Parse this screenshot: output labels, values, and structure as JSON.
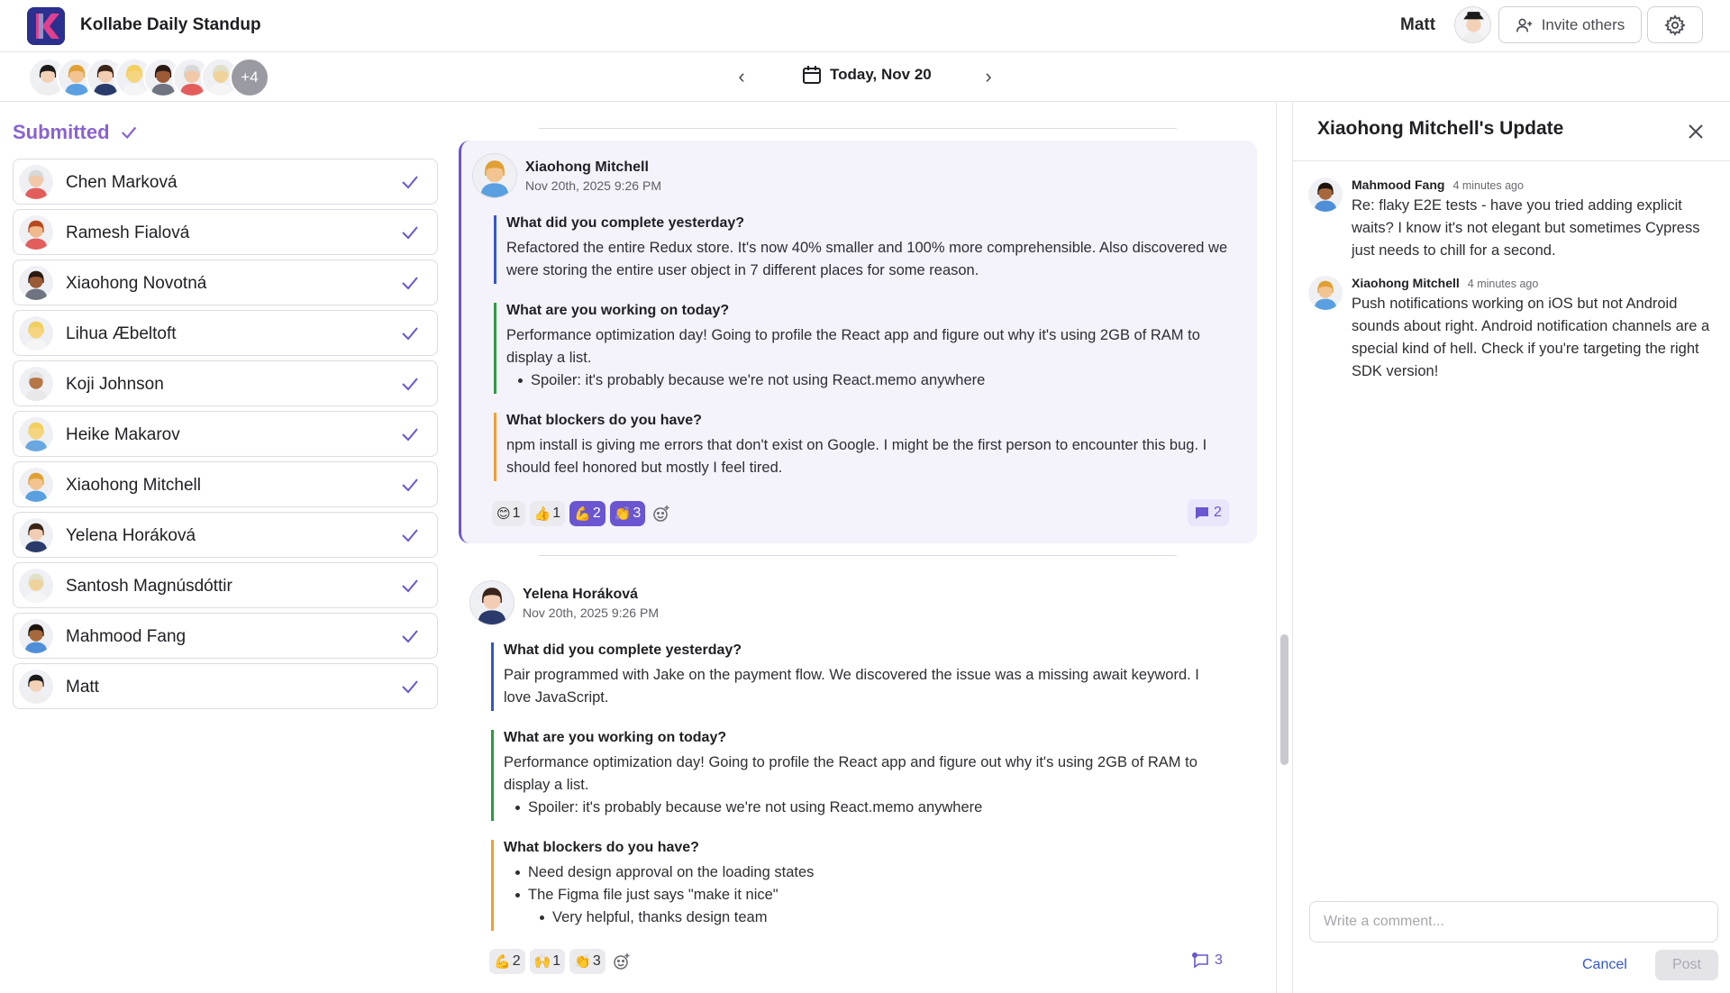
{
  "header": {
    "app_title": "Kollabe Daily Standup",
    "user_name": "Matt",
    "invite_label": "Invite others"
  },
  "subbar": {
    "more_count": "+4",
    "date_label": "Today, Nov 20",
    "prev_label": "‹",
    "next_label": "›"
  },
  "sidebar": {
    "title": "Submitted",
    "members": [
      {
        "name": "Chen Marková",
        "skin": "#f1c8a8",
        "hair": "#d8d8d8",
        "shirt": "#e35d5d"
      },
      {
        "name": "Ramesh Fialová",
        "skin": "#f0b98c",
        "hair": "#b8491f",
        "shirt": "#e35d5d"
      },
      {
        "name": "Xiaohong Novotná",
        "skin": "#9a5a36",
        "hair": "#2a1a12",
        "shirt": "#6f7480"
      },
      {
        "name": "Lihua Æbeltoft",
        "skin": "#f6d580",
        "hair": "#f2d060",
        "shirt": "#f5f5f5"
      },
      {
        "name": "Koji Johnson",
        "skin": "#b57746",
        "hair": "#e2e2e2",
        "shirt": "#e8e8e8"
      },
      {
        "name": "Heike Makarov",
        "skin": "#f6d580",
        "hair": "#f2d060",
        "shirt": "#6aa7e0"
      },
      {
        "name": "Xiaohong Mitchell",
        "skin": "#f2c491",
        "hair": "#e1a034",
        "shirt": "#5aa0e0"
      },
      {
        "name": "Yelena Horáková",
        "skin": "#f3cdb3",
        "hair": "#3a2418",
        "shirt": "#2a3a6a"
      },
      {
        "name": "Santosh Magnúsdóttir",
        "skin": "#f0d39a",
        "hair": "#e0e0c8",
        "shirt": "#f5f5f5"
      },
      {
        "name": "Mahmood Fang",
        "skin": "#a8683e",
        "hair": "#1e140e",
        "shirt": "#4f8fd8"
      },
      {
        "name": "Matt",
        "skin": "#f3d2b8",
        "hair": "#1a1a1a",
        "shirt": "#eeeeee"
      }
    ]
  },
  "feed": {
    "posts": [
      {
        "author": "Xiaohong Mitchell",
        "time": "Nov 20th, 2025 9:26 PM",
        "q1": "What did you complete yesterday?",
        "a1": "Refactored the entire Redux store. It's now 40% smaller and 100% more comprehensible. Also discovered we were storing the entire user object in 7 different places for some reason.",
        "q2": "What are you working on today?",
        "a2": "Performance optimization day! Going to profile the React app and figure out why it's using 2GB of RAM to display a list.",
        "a2_bullet": "Spoiler: it's probably because we're not using React.memo anywhere",
        "q3": "What blockers do you have?",
        "a3": "npm install is giving me errors that don't exist on Google. I might be the first person to encounter this bug. I should feel honored but mostly I feel tired.",
        "reactions": [
          {
            "emoji": "😊",
            "count": "1",
            "mine": false
          },
          {
            "emoji": "👍",
            "count": "1",
            "mine": false
          },
          {
            "emoji": "💪",
            "count": "2",
            "mine": true
          },
          {
            "emoji": "👏",
            "count": "3",
            "mine": true
          }
        ],
        "comments": "2"
      },
      {
        "author": "Yelena Horáková",
        "time": "Nov 20th, 2025 9:26 PM",
        "q1": "What did you complete yesterday?",
        "a1": "Pair programmed with Jake on the payment flow. We discovered the issue was a missing await keyword. I love JavaScript.",
        "q2": "What are you working on today?",
        "a2": "Performance optimization day! Going to profile the React app and figure out why it's using 2GB of RAM to display a list.",
        "a2_bullet": "Spoiler: it's probably because we're not using React.memo anywhere",
        "q3": "What blockers do you have?",
        "a3_bullets": [
          "Need design approval on the loading states",
          "The Figma file just says \"make it nice\""
        ],
        "a3_sub_bullet": "Very helpful, thanks design team",
        "reactions": [
          {
            "emoji": "💪",
            "count": "2",
            "mine": false
          },
          {
            "emoji": "🙌",
            "count": "1",
            "mine": false
          },
          {
            "emoji": "👏",
            "count": "3",
            "mine": false
          }
        ],
        "comments": "3"
      }
    ]
  },
  "panel": {
    "title": "Xiaohong Mitchell's Update",
    "comments": [
      {
        "author": "Mahmood Fang",
        "time": "4 minutes ago",
        "text": "Re: flaky E2E tests - have you tried adding explicit waits? I know it's not elegant but sometimes Cypress just needs to chill for a second."
      },
      {
        "author": "Xiaohong Mitchell",
        "time": "4 minutes ago",
        "text": "Push notifications working on iOS but not Android sounds about right. Android notification channels are a special kind of hell. Check if you're targeting the right SDK version!"
      }
    ],
    "input_placeholder": "Write a comment...",
    "cancel_label": "Cancel",
    "post_label": "Post"
  },
  "colors": {
    "accent": "#6b55d0",
    "submitted": "#8a63d2",
    "blue_bar": "#3557c9",
    "green_bar": "#2c9c3e",
    "orange_bar": "#f0a030"
  }
}
